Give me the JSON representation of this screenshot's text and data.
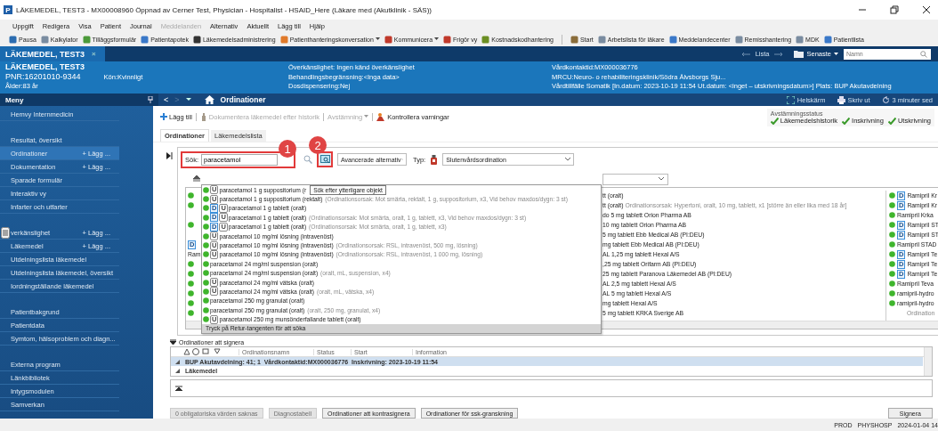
{
  "window": {
    "app_letter": "P",
    "title": "LÄKEMEDEL, TEST3 - MX00008960 Öppnad av Cerner Test, Physician - Hospitalist - HSAID_Here (Läkare med (Akutklinik - SÄS))"
  },
  "menu_bar": [
    {
      "label": "Uppgift",
      "disabled": false
    },
    {
      "label": "Redigera",
      "disabled": false
    },
    {
      "label": "Visa",
      "disabled": false
    },
    {
      "label": "Patient",
      "disabled": false
    },
    {
      "label": "Journal",
      "disabled": false
    },
    {
      "label": "Meddelanden",
      "disabled": true
    },
    {
      "label": "Alternativ",
      "disabled": false
    },
    {
      "label": "Aktuellt",
      "disabled": false
    },
    {
      "label": "Lägg till",
      "disabled": false
    },
    {
      "label": "Hjälp",
      "disabled": false
    }
  ],
  "toolbar_left": [
    {
      "label": "Pausa"
    },
    {
      "label": "Kalkylator"
    },
    {
      "label": "Tilläggsformulär"
    },
    {
      "label": "Patientapotek"
    },
    {
      "label": "Läkemedelsadministrering"
    },
    {
      "label": "Patienthanteringskonversation",
      "dropdown": true
    },
    {
      "label": "Kommunicera",
      "dropdown": true
    },
    {
      "label": "Frigör vy"
    },
    {
      "label": "Kostnadskodhantering"
    }
  ],
  "toolbar_right": [
    {
      "label": "Start"
    },
    {
      "label": "Arbetslista för läkare"
    },
    {
      "label": "Meddelandecenter"
    },
    {
      "label": "Remisshantering"
    },
    {
      "label": "MDK"
    },
    {
      "label": "Patientlista"
    }
  ],
  "patient_tab": {
    "label": "LÄKEMEDEL, TEST3",
    "close": "×"
  },
  "patient_nav": {
    "list": "Lista",
    "recent": "Senaste",
    "search_placeholder": "Namn"
  },
  "banner": {
    "name": "LÄKEMEDEL, TEST3",
    "pnr": "PNR:16201010-9344",
    "sex": "Kön:Kvinnligt",
    "age": "Ålder:83 år",
    "middle": [
      "Överkänslighet: Ingen känd överkänslighet",
      "Behandlingsbegränsning:<Inga data>",
      "Dosdispensering:Nej"
    ],
    "right": [
      "Vårdkontaktid:MX000036776",
      "MRCU:Neuro- o rehabiliteringsklinik/Södra Älvsborgs Sju...",
      "Vårdtillfälle Somatik [In.datum: 2023-10-19 11:54 Ut.datum: <inget – utskrivningsdatum>] Plats: BUP Akutavdelning"
    ]
  },
  "sidebar": {
    "title": "Meny",
    "sections": [
      [
        {
          "label": "Hemvy Internmedicin",
          "selected": false
        }
      ],
      [
        {
          "label": "Resultat, översikt",
          "selected": false
        },
        {
          "label": "Ordinationer",
          "add": "+ Lägg ...",
          "selected": true
        },
        {
          "label": "Dokumentation",
          "add": "+ Lägg ...",
          "selected": false
        },
        {
          "label": "Sparade formulär",
          "selected": false
        },
        {
          "label": "Interaktiv vy",
          "selected": false
        },
        {
          "label": "Infarter och utfarter",
          "selected": false
        }
      ],
      [
        {
          "label": "verkänslighet",
          "add": "+ Lägg ...",
          "selected": false,
          "grip": true
        },
        {
          "label": "Läkemedel",
          "add": "+ Lägg ...",
          "selected": false
        },
        {
          "label": "Utdelningslista läkemedel",
          "selected": false
        },
        {
          "label": "Utdelningslista läkemedel, översikt",
          "selected": false
        },
        {
          "label": "Iordningställande läkemedel",
          "selected": false
        }
      ],
      [
        {
          "label": "Patientbakgrund",
          "selected": false
        },
        {
          "label": "Patientdata",
          "selected": false
        },
        {
          "label": "Symtom, hälsoproblem och diagn...",
          "selected": false
        }
      ],
      [
        {
          "label": "Externa program",
          "selected": false
        },
        {
          "label": "Länkbibliotek",
          "selected": false
        },
        {
          "label": "Intygsmodulen",
          "selected": false
        },
        {
          "label": "Samverkan",
          "selected": false
        }
      ]
    ]
  },
  "nav": {
    "back": "<",
    "forward": ">",
    "title": "Ordinationer",
    "actions": [
      {
        "label": "Helskärm",
        "kind": "fullscreen"
      },
      {
        "label": "Skriv ut",
        "kind": "print"
      },
      {
        "label": "3 minuter sed",
        "kind": "refresh"
      }
    ]
  },
  "actions": [
    {
      "label": "Lägg till",
      "kind": "add",
      "disabled": false
    },
    {
      "label": "Dokumentera läkemedel efter historik",
      "kind": "document",
      "disabled": true
    },
    {
      "label": "Avstämning",
      "kind": "menu",
      "disabled": true
    },
    {
      "label": "Kontrollera varningar",
      "kind": "warning",
      "disabled": false
    }
  ],
  "reconciliation": {
    "title": "Avstämningsstatus",
    "items": [
      {
        "label": "Läkemedelshistorik",
        "checked": true
      },
      {
        "label": "Inskrivning",
        "checked": true
      },
      {
        "label": "Utskrivning",
        "checked": true
      }
    ]
  },
  "tabs": [
    {
      "label": "Ordinationer",
      "selected": true
    },
    {
      "label": "Läkemedelslista",
      "selected": false
    }
  ],
  "search": {
    "label": "Sök:",
    "value": "paracetamol",
    "advanced": "Avancerade alternativ",
    "type_label": "Typ:",
    "type_value": "Slutenvårdsordination",
    "tooltip": "Sök efter ytterligare objekt"
  },
  "annotations": [
    {
      "label": "1"
    },
    {
      "label": "2"
    }
  ],
  "suggestions": {
    "footer": "Tryck på Retur-tangenten för att söka",
    "items": [
      {
        "name": "paracetamol 1 g suppositorium (r",
        "badges": [
          "U"
        ]
      },
      {
        "name": "paracetamol 1 g suppositorium (rektalt)",
        "detail": "(Ordinationsorsak: Mot smärta, rektalt, 1 g, suppositorium, x3, Vid behov maxdos/dygn: 3 st)",
        "badges": [
          "U"
        ]
      },
      {
        "name": "paracetamol 1 g tablett (oralt)",
        "badges": [
          "D",
          "U"
        ]
      },
      {
        "name": "paracetamol 1 g tablett (oralt)",
        "detail": "(Ordinationsorsak: Mot smärta, oralt, 1 g, tablett, x3, Vid behov maxdos/dygn: 3 st)",
        "badges": [
          "D",
          "U"
        ]
      },
      {
        "name": "paracetamol 1 g tablett (oralt)",
        "detail": "(Ordinationsorsak: Mot smärta, oralt, 1 g, tablett, x3)",
        "badges": [
          "D",
          "U"
        ]
      },
      {
        "name": "paracetamol 10 mg/ml lösning (intravenöst)",
        "badges": [
          "U"
        ]
      },
      {
        "name": "paracetamol 10 mg/ml lösning (intravenöst)",
        "detail": "(Ordinationsorsak: RSL, intravenöst, 500 mg, lösning)",
        "badges": [
          "U"
        ]
      },
      {
        "name": "paracetamol 10 mg/ml lösning (intravenöst)",
        "detail": "(Ordinationsorsak: RSL, intravenöst, 1 000 mg, lösning)",
        "badges": [
          "U"
        ]
      },
      {
        "name": "paracetamol 24 mg/ml suspension (oralt)"
      },
      {
        "name": "paracetamol 24 mg/ml suspension (oralt)",
        "detail": "(oralt, mL, suspension, x4)"
      },
      {
        "name": "paracetamol 24 mg/ml vätska (oralt)",
        "badges": [
          "U"
        ]
      },
      {
        "name": "paracetamol 24 mg/ml vätska (oralt)",
        "detail": "(oralt, mL, vätska, x4)",
        "badges": [
          "U"
        ]
      },
      {
        "name": "paracetamol 250 mg granulat (oralt)"
      },
      {
        "name": "paracetamol 250 mg granulat (oralt)",
        "detail": "(oralt, 250 mg, granulat, x4)"
      },
      {
        "name": "paracetamol 250 mg munsönderfallande tablett (oralt)",
        "badges": [
          "U"
        ]
      }
    ]
  },
  "background_list": {
    "left": [
      {
        "kind": "dot"
      },
      {
        "kind": "dot"
      },
      {
        "kind": "blank"
      },
      {
        "kind": "dot"
      },
      {
        "kind": "blank"
      },
      {
        "kind": "badge",
        "text": "D"
      },
      {
        "kind": "text",
        "text": "Ram"
      },
      {
        "kind": "dot"
      },
      {
        "kind": "dot"
      },
      {
        "kind": "dot"
      },
      {
        "kind": "dot"
      },
      {
        "kind": "dot"
      },
      {
        "kind": "dot"
      }
    ],
    "middle": [
      {
        "text": "tt (oralt)"
      },
      {
        "text": "tt (oralt)",
        "detail": "Ordinationsorsak: Hypertoni, oralt, 10 mg, tablett, x1 [större än eller lika med 18 år]"
      },
      {
        "text": "do 5 mg tablett Orion Pharma AB"
      },
      {
        "text": "10 mg tablett Orion Pharma AB"
      },
      {
        "text": "5 mg tablett Ebb Medical AB (PI:DEU)"
      },
      {
        "text": "mg tablett Ebb Medical AB (PI:DEU)"
      },
      {
        "text": "AL 1,25 mg tablett Hexal A/S"
      },
      {
        "text": ",25 mg tablett Orifarm AB (PI:DEU)"
      },
      {
        "text": "25 mg tablett Paranova Läkemedel AB (PI:DEU)"
      },
      {
        "text": "AL 2,5 mg tablett Hexal A/S"
      },
      {
        "text": "AL 5 mg tablett Hexal A/S"
      },
      {
        "text": "mg tablett Hexal A/S"
      },
      {
        "text": "5 mg tablett KRKA Sverige AB"
      }
    ],
    "right": [
      {
        "kind": "item",
        "badge": "D",
        "text": "Ramipril Kr"
      },
      {
        "kind": "item",
        "badge": "D",
        "text": "Ramipril Kr"
      },
      {
        "kind": "item",
        "text": "Ramipril Krka"
      },
      {
        "kind": "item",
        "badge": "D",
        "text": "Ramipril ST"
      },
      {
        "kind": "item",
        "badge": "D",
        "text": "Ramipril ST"
      },
      {
        "kind": "item",
        "text": "Ramipril STAD"
      },
      {
        "kind": "item",
        "badge": "D",
        "text": "Ramipril Te"
      },
      {
        "kind": "item",
        "badge": "D",
        "text": "Ramipril Te"
      },
      {
        "kind": "item",
        "badge": "D",
        "text": "Ramipril Te"
      },
      {
        "kind": "item",
        "text": "Ramipril Teva"
      },
      {
        "kind": "item",
        "text": "ramipril-hydro"
      },
      {
        "kind": "item",
        "text": "ramipril-hydro"
      },
      {
        "kind": "note",
        "text": "Ordination"
      }
    ]
  },
  "signing": {
    "title": "Ordinationer att signera",
    "columns": [
      "Ordinationsnamn",
      "Status",
      "Start",
      "Information"
    ],
    "rows": [
      {
        "label": "BUP Akutavdelning: 41; 1  Vårdkontaktid:MX000036776  Inskrivning: 2023-10-19 11:54",
        "selected": true
      },
      {
        "label": "Läkemedel",
        "selected": false
      }
    ]
  },
  "buttons": [
    {
      "label": "0 obligatoriska värden saknas",
      "disabled": true
    },
    {
      "label": "Diagnostabell",
      "disabled": true
    },
    {
      "label": "Ordinationer att kontrasignera",
      "disabled": false
    },
    {
      "label": "Ordinationer för ssk-granskning",
      "disabled": false
    }
  ],
  "sign_button": "Signera",
  "status_bar": [
    "PROD",
    "PHYSHOSP",
    "2024-01-04 14"
  ]
}
